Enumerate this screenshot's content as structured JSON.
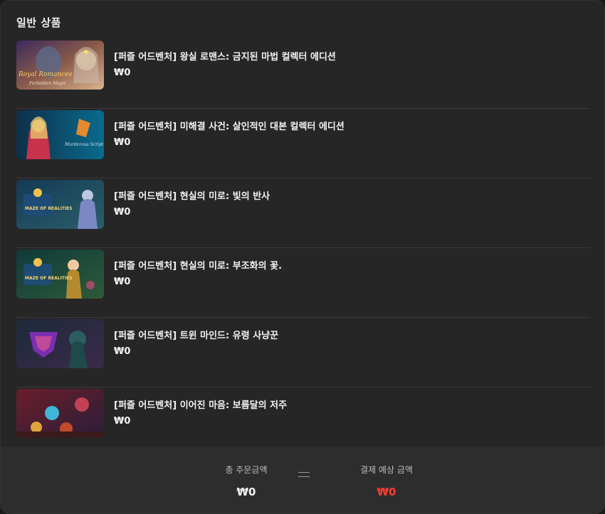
{
  "section": {
    "title": "일반 상품"
  },
  "items": [
    {
      "title": "[퍼즐 어드벤처] 왕실 로맨스: 금지된 마법 컬렉터 에디션",
      "price": "₩0",
      "image_text": [
        "Royal Romances",
        "Forbidden Magic"
      ]
    },
    {
      "title": "[퍼즐 어드벤처] 미해결 사건: 살인적인 대본 컬렉터 에디션",
      "price": "₩0",
      "image_text": [
        "Murderous Script"
      ]
    },
    {
      "title": "[퍼즐 어드벤처] 현실의 미로: 빛의 반사",
      "price": "₩0",
      "image_text": [
        "MAZE OF REALITIES"
      ]
    },
    {
      "title": "[퍼즐 어드벤처] 현실의 미로: 부조화의 꽃.",
      "price": "₩0",
      "image_text": [
        "MAZE OF REALITIES"
      ]
    },
    {
      "title": "[퍼즐 어드벤처] 트윈 마인드: 유령 사냥꾼",
      "price": "₩0",
      "image_text": []
    },
    {
      "title": "[퍼즐 어드벤처] 이어진 마음: 보름달의 저주",
      "price": "₩0",
      "image_text": []
    }
  ],
  "summary": {
    "total_label": "총 주문금액",
    "total_value": "₩0",
    "expected_label": "결제 예상 금액",
    "expected_value": "₩0"
  },
  "colors": {
    "panel_bg": "#262626",
    "footer_bg": "#2d2d2d",
    "accent_price": "#ff3b30"
  }
}
